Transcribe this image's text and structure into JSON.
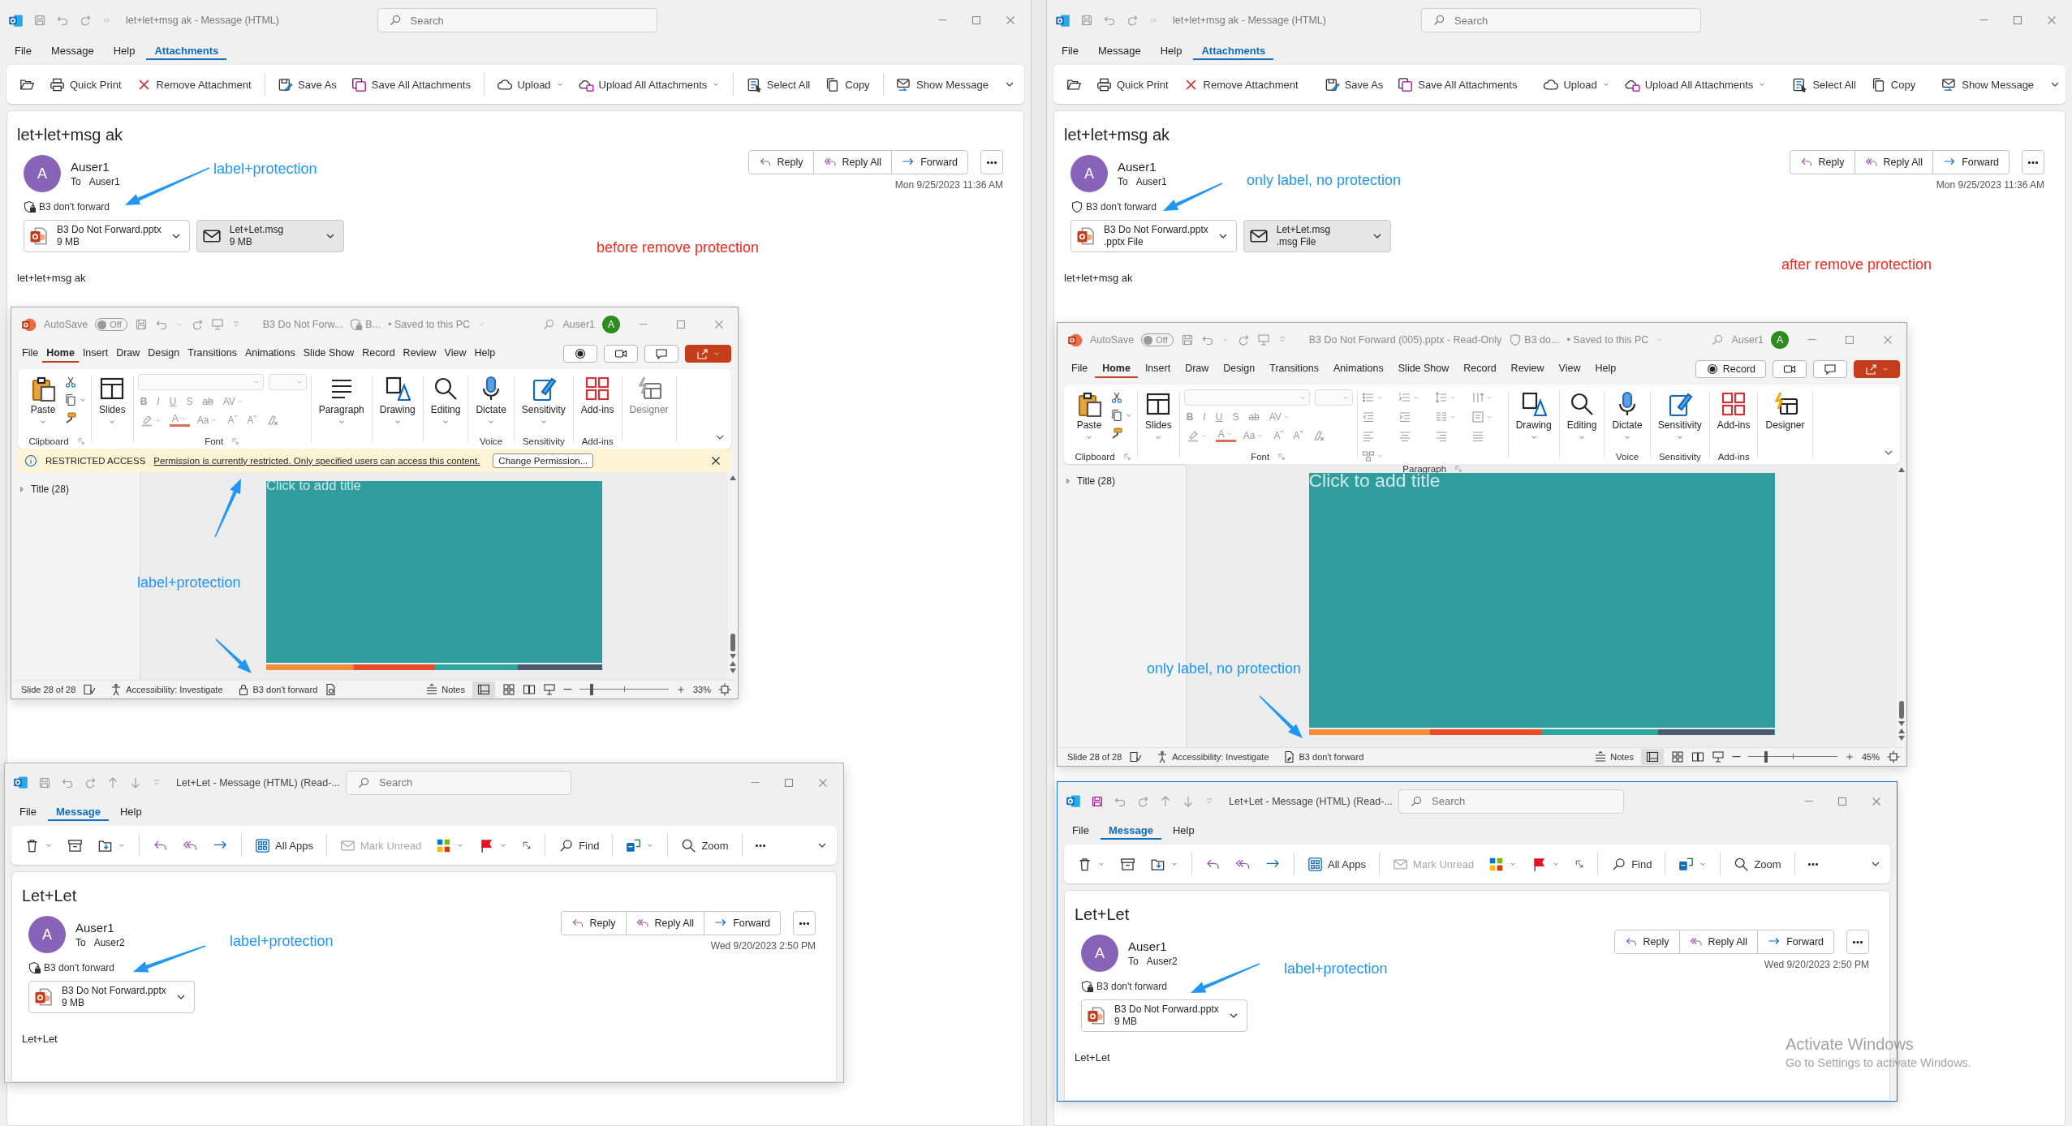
{
  "panes": [
    {
      "mail": {
        "title": "let+let+msg ak  -  Message (HTML)",
        "search": {
          "placeholder": "Search"
        },
        "tabs": [
          {
            "label": "File",
            "selected": false
          },
          {
            "label": "Message",
            "selected": false
          },
          {
            "label": "Help",
            "selected": false
          },
          {
            "label": "Attachments",
            "selected": true
          }
        ],
        "ribbon": [
          [
            {
              "kind": "open",
              "dropdown": false,
              "disabled": false
            },
            {
              "kind": "print",
              "label": "Quick Print",
              "dropdown": false,
              "disabled": false
            },
            {
              "kind": "remove",
              "label": "Remove Attachment",
              "dropdown": false,
              "disabled": false
            }
          ],
          [
            {
              "kind": "save_as",
              "label": "Save As",
              "dropdown": false,
              "disabled": false
            },
            {
              "kind": "save_all",
              "label": "Save All Attachments",
              "dropdown": false,
              "disabled": false
            }
          ],
          [
            {
              "kind": "upload",
              "label": "Upload",
              "dropdown": true,
              "disabled": false
            },
            {
              "kind": "upload_all",
              "label": "Upload All Attachments",
              "dropdown": true,
              "disabled": false
            }
          ],
          [
            {
              "kind": "select_all",
              "label": "Select All",
              "dropdown": false,
              "disabled": false
            },
            {
              "kind": "copy",
              "label": "Copy",
              "dropdown": false,
              "disabled": false
            }
          ],
          [
            {
              "kind": "show_message",
              "label": "Show Message",
              "dropdown": false,
              "disabled": false
            }
          ]
        ],
        "subject": "let+let+msg ak",
        "avatar": "A",
        "sender": "Auser1",
        "to_label": "To",
        "recipient": "Auser1",
        "sensitivity": {
          "label": "B3 don't forward",
          "protected": true
        },
        "attachments": [
          {
            "kind": "pptx",
            "name": "B3 Do Not Forward.pptx",
            "detail": "9 MB",
            "selected": false
          },
          {
            "kind": "msg",
            "name": "Let+Let.msg",
            "detail": "9 MB",
            "selected": true
          }
        ],
        "actions": [
          "Reply",
          "Reply All",
          "Forward"
        ],
        "date": "Mon 9/25/2023 11:36 AM",
        "body": "let+let+msg ak"
      },
      "ppt": {
        "autosave_label": "AutoSave",
        "autosave": {
          "on": false,
          "text": "Off"
        },
        "title": "B3 Do Not Forw...",
        "doc_label": {
          "text": "B...",
          "protected": true
        },
        "saved": "• Saved to this PC",
        "user": "Auser1",
        "avatar": "A",
        "tabs": [
          {
            "label": "File",
            "selected": false
          },
          {
            "label": "Home",
            "selected": true
          },
          {
            "label": "Insert",
            "selected": false
          },
          {
            "label": "Draw",
            "selected": false
          },
          {
            "label": "Design",
            "selected": false
          },
          {
            "label": "Transitions",
            "selected": false
          },
          {
            "label": "Animations",
            "selected": false
          },
          {
            "label": "Slide Show",
            "selected": false
          },
          {
            "label": "Record",
            "selected": false
          },
          {
            "label": "Review",
            "selected": false
          },
          {
            "label": "View",
            "selected": false
          },
          {
            "label": "Help",
            "selected": false
          }
        ],
        "ribbon": [
          {
            "kind": "clipboard",
            "button": "Paste",
            "label": "Clipboard",
            "disabled": false
          },
          {
            "kind": "slides",
            "button": "Slides",
            "disabled": false
          },
          {
            "kind": "font",
            "label": "Font",
            "row1": [
              "B",
              "I",
              "U",
              "S",
              "ab",
              "AV"
            ],
            "row2": [
              "A",
              "Aa",
              "Aˆ",
              "Aˇ"
            ],
            "disabled": true
          },
          {
            "kind": "paragraph",
            "button": "Paragraph",
            "disabled": false
          },
          {
            "kind": "drawing",
            "button": "Drawing",
            "disabled": false
          },
          {
            "kind": "editing",
            "button": "Editing",
            "disabled": false
          },
          {
            "kind": "dictate",
            "button": "Dictate",
            "label": "Voice",
            "disabled": false
          },
          {
            "kind": "sensitivity",
            "button": "Sensitivity",
            "label": "Sensitivity",
            "disabled": false
          },
          {
            "kind": "addins",
            "button": "Add-ins",
            "label": "Add-ins",
            "disabled": false
          },
          {
            "kind": "designer",
            "button": "Designer",
            "disabled": true
          }
        ],
        "message_bar": {
          "title": "RESTRICTED ACCESS",
          "text": "Permission is currently restricted. Only specified users can access this content.",
          "button": "Change Permission..."
        },
        "outline": "Title (28)",
        "slide": {
          "placeholder": "Click to add title"
        },
        "status": {
          "slide": "Slide 28 of 28",
          "accessibility": "Accessibility: Investigate",
          "sensitivity": {
            "label": "B3 don't forward",
            "protected": true
          },
          "notes": "Notes",
          "zoom": {
            "level": 0.14,
            "reading": "33%"
          }
        }
      },
      "mail2": {
        "active": false,
        "title": "Let+Let  -  Message (HTML) (Read-...",
        "search": {
          "placeholder": "Search"
        },
        "tabs": [
          {
            "label": "File",
            "selected": false
          },
          {
            "label": "Message",
            "selected": true
          },
          {
            "label": "Help",
            "selected": false
          }
        ],
        "ribbon": [
          [
            {
              "kind": "trash",
              "dropdown": true,
              "disabled": false
            },
            {
              "kind": "archive",
              "dropdown": false,
              "disabled": false
            },
            {
              "kind": "move",
              "dropdown": true,
              "disabled": false
            }
          ],
          [
            {
              "kind": "reply",
              "dropdown": false,
              "disabled": false
            },
            {
              "kind": "reply_all",
              "dropdown": false,
              "disabled": false
            },
            {
              "kind": "forward",
              "dropdown": false,
              "disabled": false
            }
          ],
          [
            {
              "kind": "all_apps",
              "label": "All Apps",
              "dropdown": false,
              "disabled": false
            }
          ],
          [
            {
              "kind": "mark_unread",
              "label": "Mark Unread",
              "dropdown": false,
              "disabled": true
            },
            {
              "kind": "categorize",
              "dropdown": true,
              "disabled": false
            },
            {
              "kind": "flag",
              "dropdown": true,
              "disabled": false
            },
            {
              "kind": "launcher",
              "dropdown": false,
              "disabled": false
            }
          ],
          [
            {
              "kind": "find",
              "label": "Find",
              "dropdown": false,
              "disabled": false
            }
          ],
          [
            {
              "kind": "translate",
              "dropdown": true,
              "disabled": false
            }
          ],
          [
            {
              "kind": "zoom",
              "label": "Zoom",
              "dropdown": false,
              "disabled": false
            }
          ],
          [
            {
              "kind": "more",
              "dropdown": false,
              "disabled": false
            }
          ]
        ],
        "subject": "Let+Let",
        "avatar": "A",
        "sender": "Auser1",
        "to_label": "To",
        "recipient": "Auser2",
        "sensitivity": {
          "label": "B3 don't forward",
          "protected": true
        },
        "attachments": [
          {
            "kind": "pptx",
            "name": "B3 Do Not Forward.pptx",
            "detail": "9 MB",
            "selected": false
          }
        ],
        "actions": [
          "Reply",
          "Reply All",
          "Forward"
        ],
        "date": "Wed 9/20/2023 2:50 PM",
        "body": "Let+Let"
      },
      "notes": [
        {
          "text": "label+protection",
          "color": "#2196f3"
        },
        {
          "text": "before remove protection",
          "color": "#f0281e"
        },
        {
          "text": "label+protection",
          "color": "#2196f3"
        },
        {
          "text": "label+protection",
          "color": "#2196f3"
        }
      ]
    },
    {
      "mail": {
        "title": "let+let+msg ak  -  Message (HTML)",
        "search": {
          "placeholder": "Search"
        },
        "tabs": [
          {
            "label": "File",
            "selected": false
          },
          {
            "label": "Message",
            "selected": false
          },
          {
            "label": "Help",
            "selected": false
          },
          {
            "label": "Attachments",
            "selected": true
          }
        ],
        "ribbon": [
          [
            {
              "kind": "open",
              "dropdown": false,
              "disabled": false
            },
            {
              "kind": "print",
              "label": "Quick Print",
              "dropdown": false,
              "disabled": false
            },
            {
              "kind": "remove",
              "label": "Remove Attachment",
              "dropdown": false,
              "disabled": false
            }
          ],
          [
            {
              "kind": "save_as",
              "label": "Save As",
              "dropdown": false,
              "disabled": false
            },
            {
              "kind": "save_all",
              "label": "Save All Attachments",
              "dropdown": false,
              "disabled": false
            }
          ],
          [
            {
              "kind": "upload",
              "label": "Upload",
              "dropdown": true,
              "disabled": false
            },
            {
              "kind": "upload_all",
              "label": "Upload All Attachments",
              "dropdown": true,
              "disabled": false
            }
          ],
          [
            {
              "kind": "select_all",
              "label": "Select All",
              "dropdown": false,
              "disabled": false
            },
            {
              "kind": "copy",
              "label": "Copy",
              "dropdown": false,
              "disabled": false
            }
          ],
          [
            {
              "kind": "show_message",
              "label": "Show Message",
              "dropdown": false,
              "disabled": false
            }
          ]
        ],
        "subject": "let+let+msg ak",
        "avatar": "A",
        "sender": "Auser1",
        "to_label": "To",
        "recipient": "Auser1",
        "sensitivity": {
          "label": "B3 don't forward",
          "protected": false
        },
        "attachments": [
          {
            "kind": "pptx",
            "name": "B3 Do Not Forward.pptx",
            "detail": ".pptx File",
            "selected": false
          },
          {
            "kind": "msg",
            "name": "Let+Let.msg",
            "detail": ".msg File",
            "selected": true
          }
        ],
        "actions": [
          "Reply",
          "Reply All",
          "Forward"
        ],
        "date": "Mon 9/25/2023 11:36 AM",
        "body": "let+let+msg ak"
      },
      "ppt": {
        "autosave_label": "AutoSave",
        "autosave": {
          "on": false,
          "text": "Off"
        },
        "title": "B3 Do Not Forward (005).pptx  -  Read-Only",
        "doc_label": {
          "text": "B3 do...",
          "protected": false
        },
        "saved": "• Saved to this PC",
        "user": "Auser1",
        "avatar": "A",
        "record_label": "Record",
        "tabs": [
          {
            "label": "File",
            "selected": false
          },
          {
            "label": "Home",
            "selected": true
          },
          {
            "label": "Insert",
            "selected": false
          },
          {
            "label": "Draw",
            "selected": false
          },
          {
            "label": "Design",
            "selected": false
          },
          {
            "label": "Transitions",
            "selected": false
          },
          {
            "label": "Animations",
            "selected": false
          },
          {
            "label": "Slide Show",
            "selected": false
          },
          {
            "label": "Record",
            "selected": false
          },
          {
            "label": "Review",
            "selected": false
          },
          {
            "label": "View",
            "selected": false
          },
          {
            "label": "Help",
            "selected": false
          }
        ],
        "ribbon": [
          {
            "kind": "clipboard",
            "button": "Paste",
            "label": "Clipboard",
            "disabled": false
          },
          {
            "kind": "slides",
            "button": "Slides",
            "disabled": false
          },
          {
            "kind": "font",
            "label": "Font",
            "row1": [
              "B",
              "I",
              "U",
              "S",
              "ab",
              "AV"
            ],
            "row2": [
              "A",
              "Aa",
              "Aˆ",
              "Aˇ"
            ],
            "disabled": true
          },
          {
            "kind": "paragraph_panel",
            "label": "Paragraph",
            "disabled": true
          },
          {
            "kind": "drawing",
            "button": "Drawing",
            "disabled": false
          },
          {
            "kind": "editing",
            "button": "Editing",
            "disabled": false
          },
          {
            "kind": "dictate",
            "button": "Dictate",
            "label": "Voice",
            "disabled": false
          },
          {
            "kind": "sensitivity",
            "button": "Sensitivity",
            "label": "Sensitivity",
            "disabled": false
          },
          {
            "kind": "addins",
            "button": "Add-ins",
            "label": "Add-ins",
            "disabled": false
          },
          {
            "kind": "designer",
            "button": "Designer",
            "disabled": false
          }
        ],
        "outline": "Title (28)",
        "slide": {
          "placeholder": "Click to add title"
        },
        "status": {
          "slide": "Slide 28 of 28",
          "accessibility": "Accessibility: Investigate",
          "sensitivity": {
            "label": "B3 don't forward",
            "protected": false
          },
          "notes": "Notes",
          "zoom": {
            "level": 0.2,
            "reading": "45%"
          }
        }
      },
      "mail2": {
        "active": true,
        "title": "Let+Let  -  Message (HTML) (Read-...",
        "search": {
          "placeholder": "Search"
        },
        "tabs": [
          {
            "label": "File",
            "selected": false
          },
          {
            "label": "Message",
            "selected": true
          },
          {
            "label": "Help",
            "selected": false
          }
        ],
        "ribbon": [
          [
            {
              "kind": "trash",
              "dropdown": true,
              "disabled": false
            },
            {
              "kind": "archive",
              "dropdown": false,
              "disabled": false
            },
            {
              "kind": "move",
              "dropdown": true,
              "disabled": false
            }
          ],
          [
            {
              "kind": "reply",
              "dropdown": false,
              "disabled": false
            },
            {
              "kind": "reply_all",
              "dropdown": false,
              "disabled": false
            },
            {
              "kind": "forward",
              "dropdown": false,
              "disabled": false
            }
          ],
          [
            {
              "kind": "all_apps",
              "label": "All Apps",
              "dropdown": false,
              "disabled": false
            }
          ],
          [
            {
              "kind": "mark_unread",
              "label": "Mark Unread",
              "dropdown": false,
              "disabled": true
            },
            {
              "kind": "categorize",
              "dropdown": true,
              "disabled": false
            },
            {
              "kind": "flag",
              "dropdown": true,
              "disabled": false
            },
            {
              "kind": "launcher",
              "dropdown": false,
              "disabled": false
            }
          ],
          [
            {
              "kind": "find",
              "label": "Find",
              "dropdown": false,
              "disabled": false
            }
          ],
          [
            {
              "kind": "translate",
              "dropdown": true,
              "disabled": false
            }
          ],
          [
            {
              "kind": "zoom",
              "label": "Zoom",
              "dropdown": false,
              "disabled": false
            }
          ],
          [
            {
              "kind": "more",
              "dropdown": false,
              "disabled": false
            }
          ]
        ],
        "subject": "Let+Let",
        "avatar": "A",
        "sender": "Auser1",
        "to_label": "To",
        "recipient": "Auser2",
        "sensitivity": {
          "label": "B3 don't forward",
          "protected": true
        },
        "attachments": [
          {
            "kind": "pptx",
            "name": "B3 Do Not Forward.pptx",
            "detail": "9 MB",
            "selected": false
          }
        ],
        "actions": [
          "Reply",
          "Reply All",
          "Forward"
        ],
        "date": "Wed 9/20/2023 2:50 PM",
        "body": "Let+Let"
      },
      "notes": [
        {
          "text": "only label, no protection",
          "color": "#2196f3"
        },
        {
          "text": "after remove protection",
          "color": "#f0281e"
        },
        {
          "text": "only label, no protection",
          "color": "#2196f3"
        },
        {
          "text": "label+protection",
          "color": "#2196f3"
        }
      ]
    }
  ],
  "system_notice": {
    "title": "Activate Windows",
    "text": "Go to Settings to activate Windows."
  }
}
